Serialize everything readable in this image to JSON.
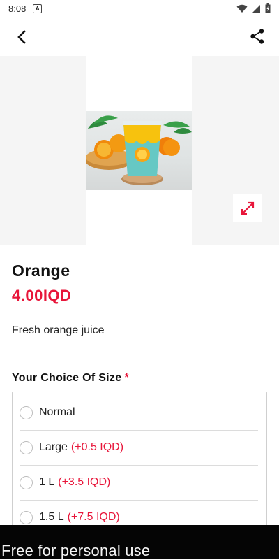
{
  "status_bar": {
    "time": "8:08",
    "notification_icon": "a-badge-icon",
    "wifi_icon": "wifi-icon",
    "signal_icon": "signal-icon",
    "battery_icon": "battery-icon"
  },
  "app_bar": {
    "back_icon": "back-arrow-icon",
    "share_icon": "share-icon"
  },
  "product": {
    "name": "Orange",
    "price": "4.00IQD",
    "description": "Fresh orange juice",
    "image_alt": "orange juice cup",
    "expand_icon": "expand-icon"
  },
  "size_section": {
    "title": "Your Choice Of Size",
    "required_mark": "*",
    "options": [
      {
        "label": "Normal",
        "extra": ""
      },
      {
        "label": "Large",
        "extra": "(+0.5 IQD)"
      },
      {
        "label": "1 L",
        "extra": "(+3.5 IQD)"
      },
      {
        "label": "1.5 L",
        "extra": "(+7.5 IQD)"
      }
    ]
  },
  "banner": {
    "text": "Free for personal use"
  },
  "colors": {
    "accent": "#e8163a",
    "banner_bg": "#050505"
  }
}
